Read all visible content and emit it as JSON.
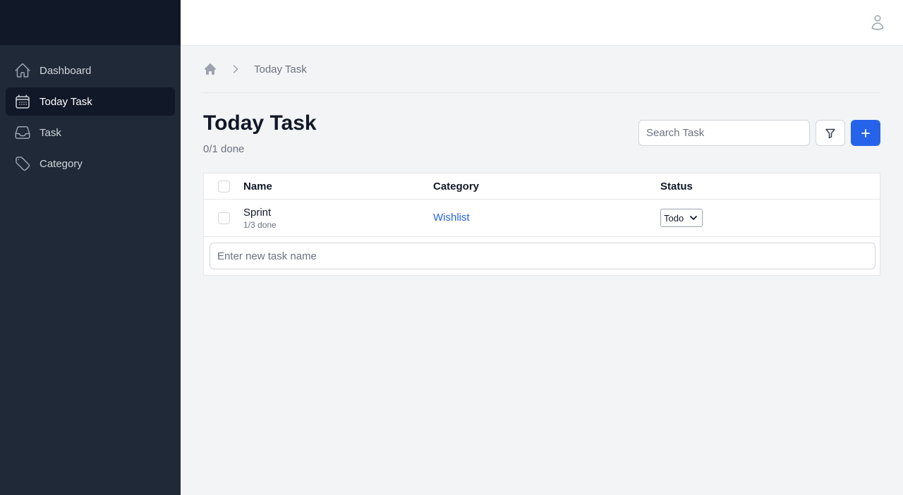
{
  "sidebar": {
    "items": [
      {
        "label": "Dashboard",
        "icon": "home-icon",
        "active": false
      },
      {
        "label": "Today Task",
        "icon": "calendar-icon",
        "active": true
      },
      {
        "label": "Task",
        "icon": "inbox-icon",
        "active": false
      },
      {
        "label": "Category",
        "icon": "tag-icon",
        "active": false
      }
    ]
  },
  "header": {
    "user_icon": "user-icon"
  },
  "breadcrumb": {
    "home_icon": "home-icon",
    "separator_icon": "chevron-right-icon",
    "current": "Today Task"
  },
  "page": {
    "title": "Today Task",
    "done_count": "0/1 done"
  },
  "toolbar": {
    "search_placeholder": "Search Task",
    "filter_icon": "filter-icon",
    "add_icon": "plus-icon"
  },
  "table": {
    "headers": {
      "name": "Name",
      "category": "Category",
      "status": "Status"
    },
    "rows": [
      {
        "name": "Sprint",
        "progress": "1/3 done",
        "category": "Wishlist",
        "status": "Todo"
      }
    ],
    "new_task_placeholder": "Enter new task name"
  },
  "colors": {
    "sidebar_bg": "#1f2937",
    "sidebar_top": "#111827",
    "accent": "#2563eb",
    "link": "#2563eb",
    "page_bg": "#f3f4f6"
  }
}
